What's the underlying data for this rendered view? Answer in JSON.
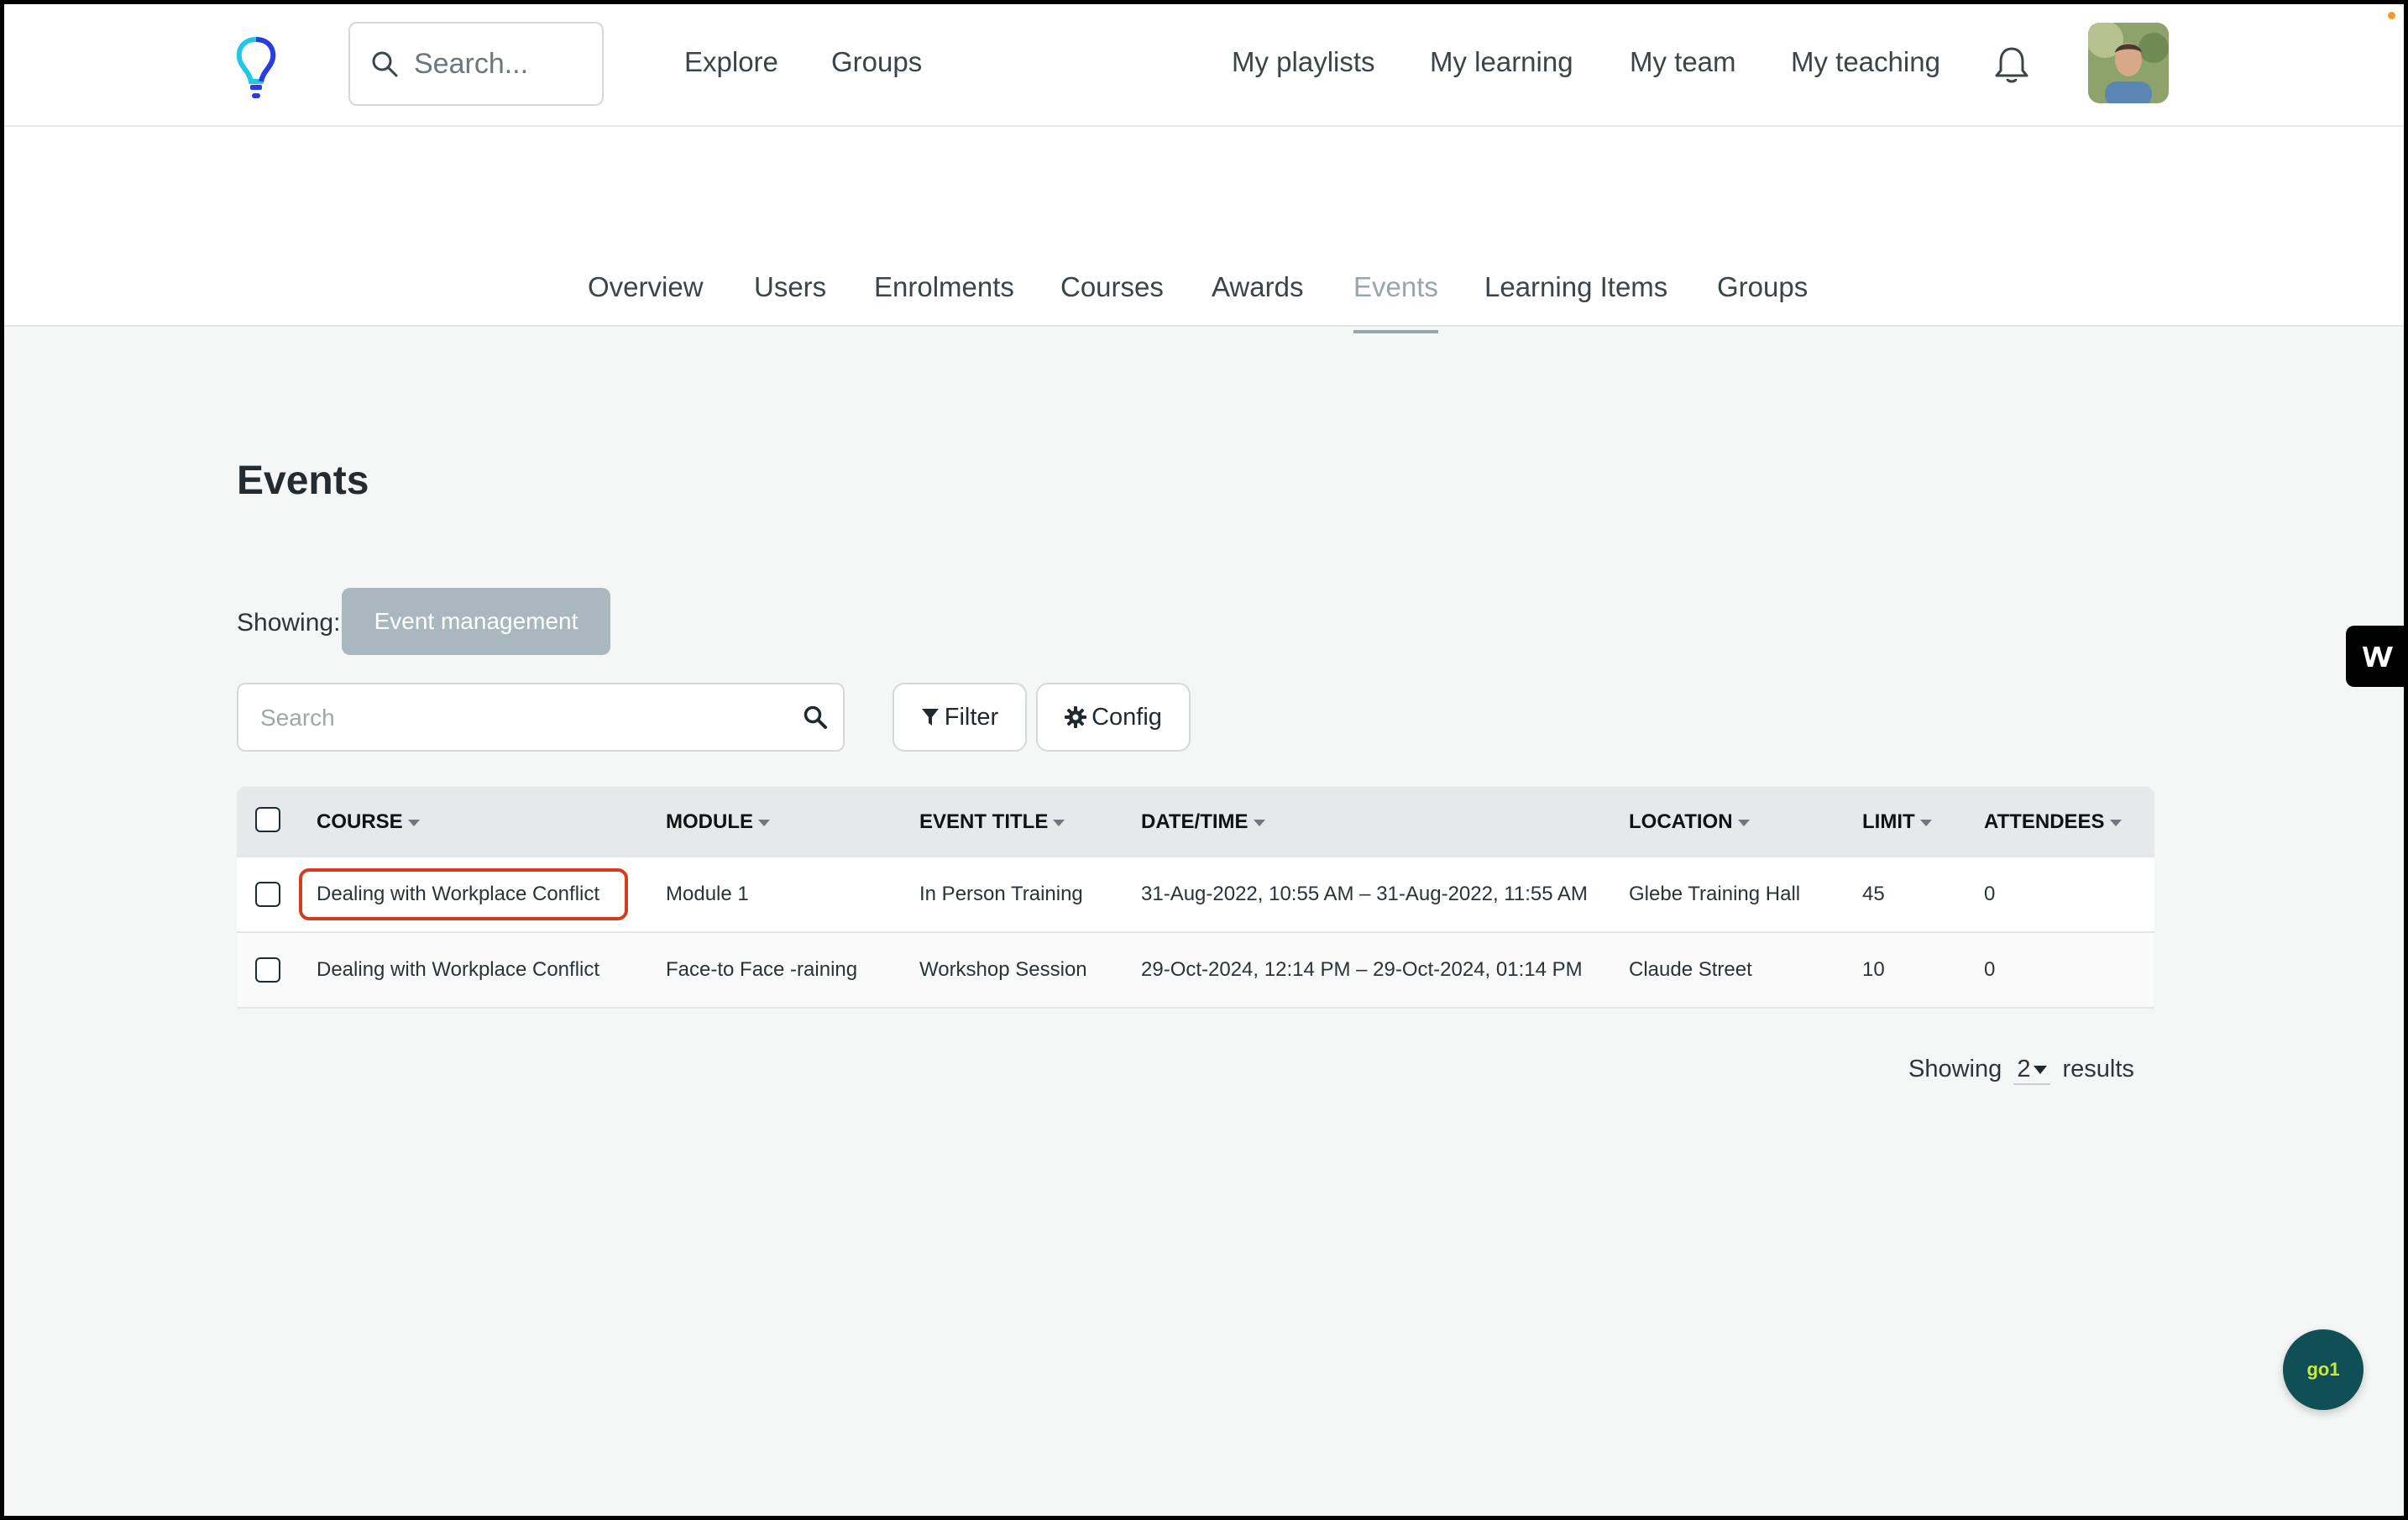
{
  "topbar": {
    "search_placeholder": "Search...",
    "nav_left": [
      "Explore",
      "Groups"
    ],
    "nav_right": [
      "My playlists",
      "My learning",
      "My team",
      "My teaching"
    ],
    "icons": [
      "lightbulb-logo-icon",
      "search-icon",
      "bell-icon",
      "avatar"
    ]
  },
  "subnav": {
    "tabs": [
      "Overview",
      "Users",
      "Enrolments",
      "Courses",
      "Awards",
      "Events",
      "Learning Items",
      "Groups"
    ],
    "active": "Events"
  },
  "page": {
    "title": "Events",
    "showing_label": "Showing:",
    "showing_chip": "Event management",
    "search_placeholder": "Search",
    "filter_label": "Filter",
    "config_label": "Config"
  },
  "table": {
    "columns": [
      "COURSE",
      "MODULE",
      "EVENT TITLE",
      "DATE/TIME",
      "LOCATION",
      "LIMIT",
      "ATTENDEES"
    ],
    "rows": [
      {
        "course": "Dealing with Workplace Conflict",
        "module": "Module 1",
        "event_title": "In Person Training",
        "datetime": "31-Aug-2022, 10:55 AM – 31-Aug-2022, 11:55 AM",
        "location": "Glebe Training Hall",
        "limit": "45",
        "attendees": "0"
      },
      {
        "course": "Dealing with Workplace Conflict",
        "module": "Face-to Face -raining",
        "event_title": "Workshop Session",
        "datetime": "29-Oct-2024, 12:14 PM – 29-Oct-2024, 01:14 PM",
        "location": "Claude Street",
        "limit": "10",
        "attendees": "0"
      }
    ]
  },
  "footer": {
    "showing": "Showing",
    "count": "2",
    "results": "results"
  },
  "widgets": {
    "w_label": "W",
    "go1_label": "go1"
  },
  "colors": {
    "highlight": "#d43d1c",
    "chip": "#a9b7bf",
    "go1_bg": "#0f4f55"
  }
}
